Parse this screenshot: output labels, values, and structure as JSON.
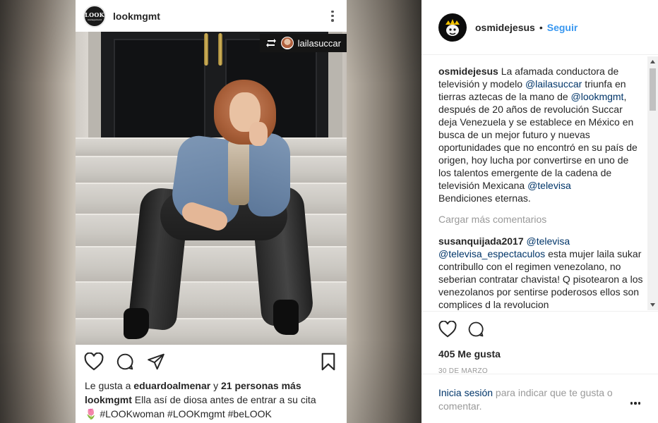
{
  "post_card": {
    "username": "lookmgmt",
    "avatar_logo_text": "LOOK",
    "avatar_logo_sub": "management",
    "repost_username": "lailasuccar",
    "likes_prefix": "Le gusta a ",
    "likes_user": "eduardoalmenar",
    "likes_conjunction": " y ",
    "likes_others": "21 personas más",
    "caption_user": "lookmgmt",
    "caption_text": " Ella así de diosa antes de entrar a su cita",
    "caption_emoji": "🌷",
    "caption_hashtags": " #LOOKwoman #LOOKmgmt #beLOOK"
  },
  "panel": {
    "username": "osmidejesus",
    "dot": "•",
    "follow_label": "Seguir",
    "caption": {
      "user": "osmidejesus",
      "t1": " La afamada conductora de televisión y modelo ",
      "m1": "@lailasuccar",
      "t2": " triunfa en tierras aztecas de la mano de ",
      "m2": "@lookmgmt",
      "t3": ", después de 20 años de revolución Succar deja Venezuela y se establece en México en busca de un mejor futuro y nuevas oportunidades que no encontró en su país de origen, hoy lucha por convertirse en uno de los talentos emergente de la cadena de televisión Mexicana ",
      "m3": "@televisa",
      "t4": " Bendiciones eternas."
    },
    "load_more": "Cargar más comentarios",
    "comment": {
      "user": "susanquijada2017",
      "m1": "@televisa",
      "m2": "@televisa_espectaculos",
      "text": " esta mujer laila sukar contribullo con el regimen venezolano, no seberian contratar chavista! Q pisotearon a los venezolanos por sentirse poderosos ellos son complices d la revolucion"
    },
    "likes": "405 Me gusta",
    "date": "30 DE MARZO",
    "login_link": "Inicia sesión",
    "login_text": " para indicar que te gusta o comentar."
  }
}
